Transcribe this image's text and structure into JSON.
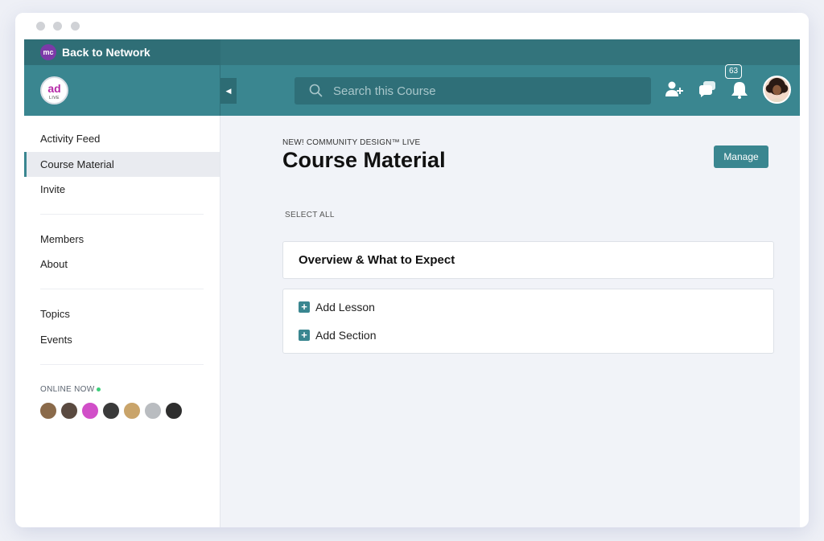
{
  "network": {
    "logo_text": "mc",
    "back_label": "Back to Network"
  },
  "course": {
    "logo_main": "ad",
    "logo_sub": "LIVE"
  },
  "search": {
    "placeholder": "Search this Course"
  },
  "header": {
    "notification_count": "63"
  },
  "sidebar": {
    "items": [
      {
        "label": "Activity Feed"
      },
      {
        "label": "Course Material"
      },
      {
        "label": "Invite"
      },
      {
        "label": "Members"
      },
      {
        "label": "About"
      },
      {
        "label": "Topics"
      },
      {
        "label": "Events"
      }
    ],
    "active_index": 1,
    "online_label": "ONLINE NOW"
  },
  "main": {
    "eyebrow": "NEW! COMMUNITY DESIGN™ LIVE",
    "title": "Course Material",
    "manage_label": "Manage",
    "select_all": "SELECT ALL",
    "section_title": "Overview & What to Expect",
    "add_lesson": "Add Lesson",
    "add_section": "Add Section"
  },
  "colors": {
    "teal": "#3a8690",
    "teal_dark": "#2f6e76",
    "online": "#3ccf7a",
    "logo_magenta": "#b62aa8"
  }
}
